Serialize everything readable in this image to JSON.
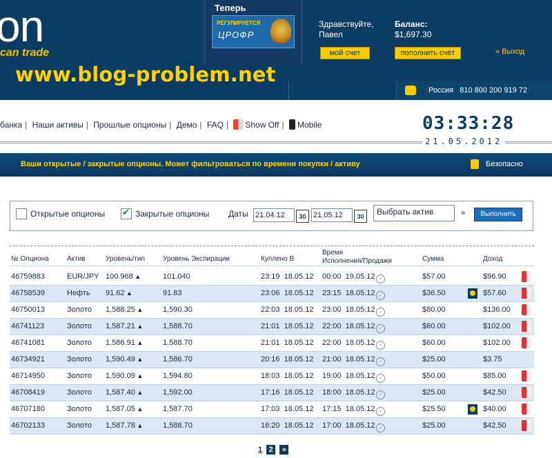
{
  "header": {
    "logo": "on",
    "tagline": "can trade",
    "site_url": "www.blog-problem.net",
    "promo_title": "Теперь",
    "promo_line1": "РЕГУЛИРУЕТСЯ",
    "promo_line2": "ЦРОФР",
    "greeting": "Здравствуйте, Павел",
    "balance_label": "Баланс:",
    "balance_value": "$1,697.30",
    "account_button": "мой счет",
    "deposit_button": "пополнить счёт",
    "logout": "» Выход",
    "phone_country": "Россия",
    "phone_number": "810 800 200 919 72"
  },
  "nav": {
    "items": [
      "банка",
      "Наши активы",
      "Прошлые опционы",
      "Демо",
      "FAQ",
      "Show Off",
      "Mobile"
    ]
  },
  "clock": {
    "time": "03:33:28",
    "date": "21.05.2012"
  },
  "banner": {
    "text": "Ваши открытые / закрытые опционы. Может фильтроваться по времени покупки / активу",
    "secure": "Безопасно"
  },
  "filter": {
    "open_label": "Открытые опционы",
    "open_checked": false,
    "closed_label": "Закрытые опционы",
    "closed_checked": true,
    "dates_label": "Даты",
    "date_from": "21.04.12",
    "date_to": "21.05.12",
    "cal_day": "30",
    "asset_select": "Выбрать актив",
    "run_button": "Выполнить"
  },
  "table": {
    "headers": {
      "id": "№ Опциона",
      "asset": "Актив",
      "level": "Уровень/тип",
      "expiry_level": "Уровень Экспирации",
      "bought": "Куплено В",
      "time_l1": "Время",
      "time_l2": "Исполнения/Продажи",
      "amount": "Сумма",
      "income": "Доход"
    },
    "rows": [
      {
        "id": "46759883",
        "asset": "EUR/JPY",
        "level": "100.968",
        "expiry": "101.040",
        "bought": "23:19  18.05.12",
        "exec": "00:00  19.05.12",
        "amount": "$57.00",
        "income": "$96.90",
        "coin": false,
        "flag": true
      },
      {
        "id": "46758539",
        "asset": "Нефть",
        "level": "91.62",
        "expiry": "91.83",
        "bought": "23:06  18.05.12",
        "exec": "23:15  18.05.12",
        "amount": "$36.50",
        "income": "$57.60",
        "coin": true,
        "flag": true
      },
      {
        "id": "46750013",
        "asset": "Золото",
        "level": "1,588.25",
        "expiry": "1,590.30",
        "bought": "22:03  18.05.12",
        "exec": "23:00  18.05.12",
        "amount": "$80.00",
        "income": "$136.00",
        "coin": false,
        "flag": true
      },
      {
        "id": "46741123",
        "asset": "Золото",
        "level": "1,587.21",
        "expiry": "1,588.70",
        "bought": "21:01  18.05.12",
        "exec": "22:00  18.05.12",
        "amount": "$60.00",
        "income": "$102.00",
        "coin": false,
        "flag": true
      },
      {
        "id": "46741081",
        "asset": "Золото",
        "level": "1,586.91",
        "expiry": "1,588.70",
        "bought": "21:01  18.05.12",
        "exec": "22:00  18.05.12",
        "amount": "$60.00",
        "income": "$102.00",
        "coin": false,
        "flag": true
      },
      {
        "id": "46734921",
        "asset": "Золото",
        "level": "1,590.49",
        "expiry": "1,586.70",
        "bought": "20:16  18.05.12",
        "exec": "21:00  18.05.12",
        "amount": "$25.00",
        "income": "$3.75",
        "coin": false,
        "flag": false
      },
      {
        "id": "46714950",
        "asset": "Золото",
        "level": "1,590.09",
        "expiry": "1,594.80",
        "bought": "18:03  18.05.12",
        "exec": "19:00  18.05.12",
        "amount": "$50.00",
        "income": "$85.00",
        "coin": false,
        "flag": true
      },
      {
        "id": "46708419",
        "asset": "Золото",
        "level": "1,587.40",
        "expiry": "1,592.00",
        "bought": "17:16  18.05.12",
        "exec": "18:00  18.05.12",
        "amount": "$25.00",
        "income": "$42.50",
        "coin": false,
        "flag": true
      },
      {
        "id": "46707180",
        "asset": "Золото",
        "level": "1,587.05",
        "expiry": "1,587.70",
        "bought": "17:03  18.05.12",
        "exec": "17:15  18.05.12",
        "amount": "$25.50",
        "income": "$40.00",
        "coin": true,
        "flag": true
      },
      {
        "id": "46702133",
        "asset": "Золото",
        "level": "1,587.78",
        "expiry": "1,588.70",
        "bought": "16:20  18.05.12",
        "exec": "17:00  18.05.12",
        "amount": "$25.00",
        "income": "$42.50",
        "coin": false,
        "flag": true
      }
    ]
  },
  "pager": {
    "page1": "1",
    "page2": "2",
    "next": "»"
  }
}
